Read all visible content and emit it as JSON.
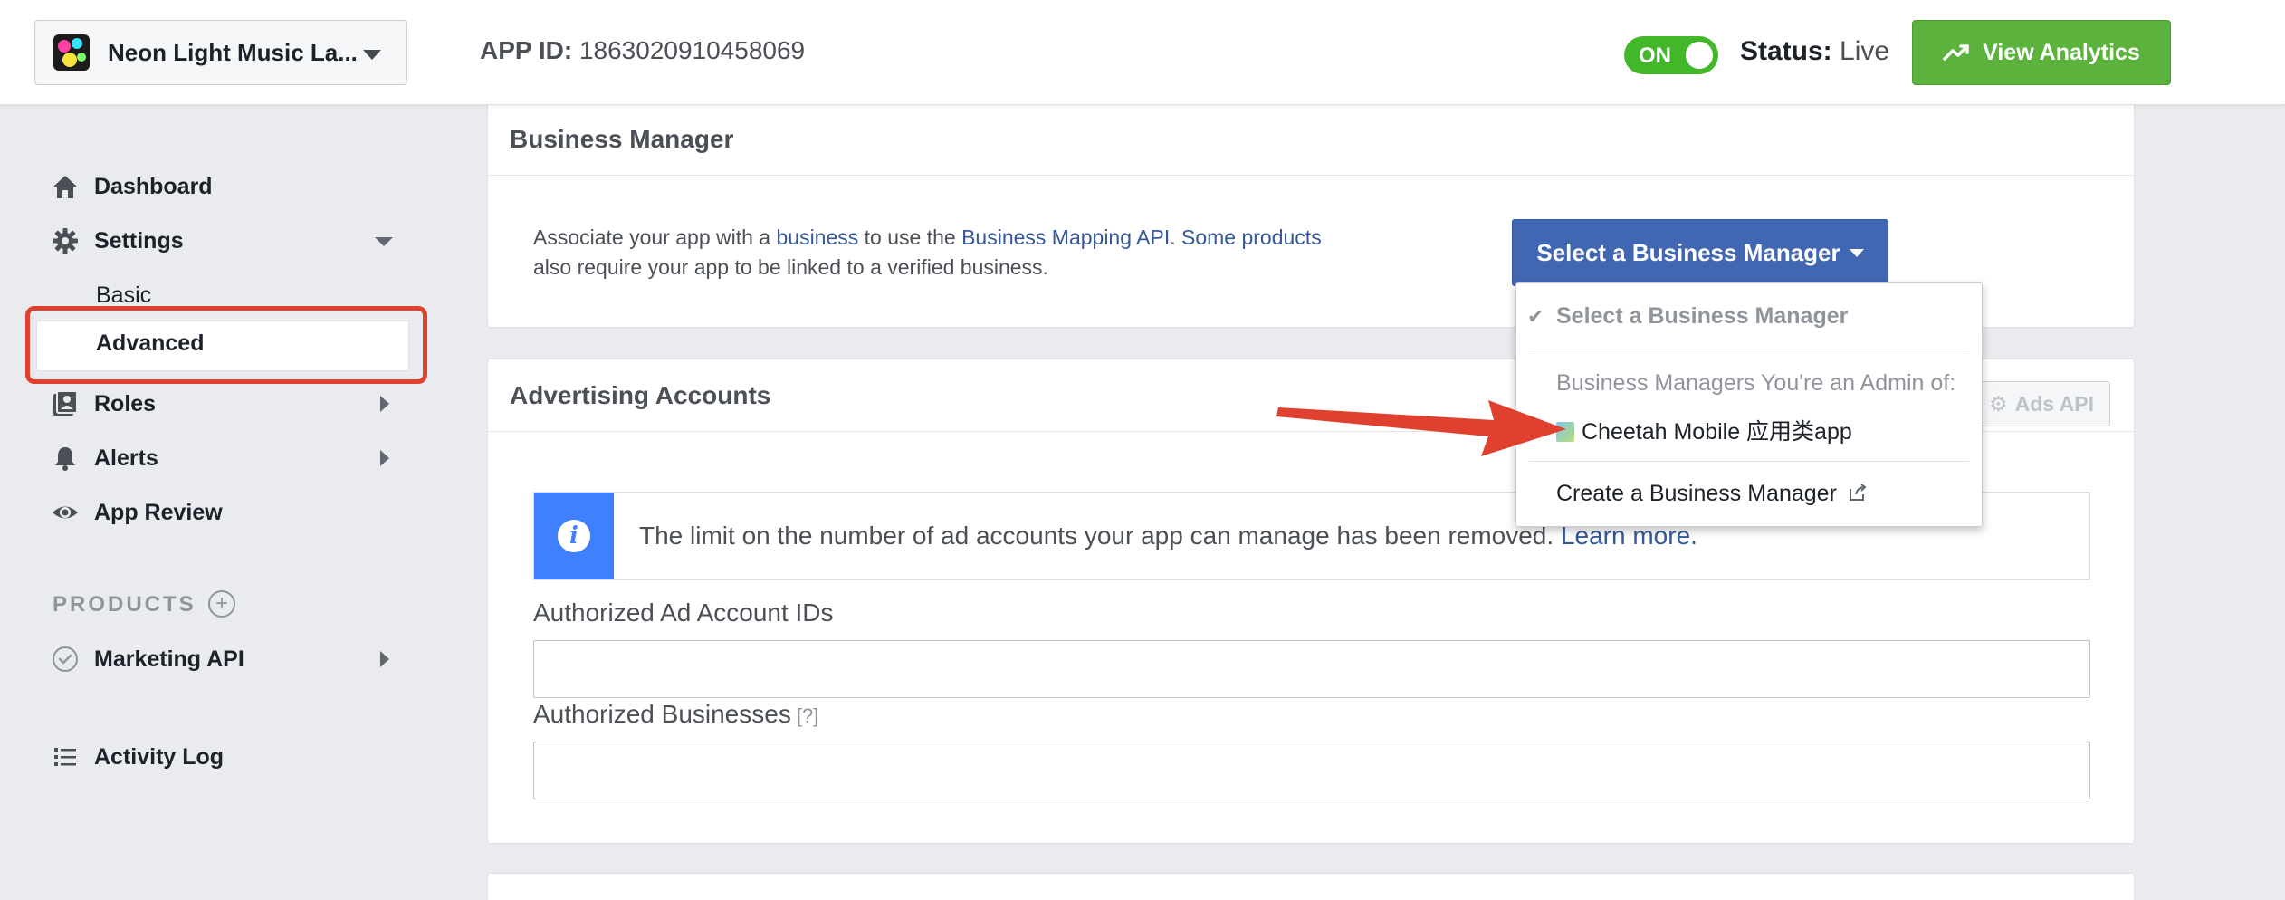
{
  "header": {
    "app_name": "Neon Light Music La...",
    "app_id_label": "APP ID:",
    "app_id_value": "1863020910458069",
    "toggle_label": "ON",
    "status_label": "Status:",
    "status_value": "Live",
    "analytics_label": "View Analytics"
  },
  "sidebar": {
    "dashboard": "Dashboard",
    "settings": "Settings",
    "basic": "Basic",
    "advanced": "Advanced",
    "roles": "Roles",
    "alerts": "Alerts",
    "app_review": "App Review",
    "products_heading": "PRODUCTS",
    "marketing_api": "Marketing API",
    "activity_log": "Activity Log"
  },
  "business_manager": {
    "title": "Business Manager",
    "desc_1": "Associate your app with a ",
    "link_business": "business",
    "desc_2": " to use the ",
    "link_mapping": "Business Mapping API",
    "desc_3": ". ",
    "link_products": "Some products",
    "desc_4": " also require your app to be linked to a verified business.",
    "select_button": "Select a Business Manager"
  },
  "dropdown": {
    "selected": "Select a Business Manager",
    "admin_heading": "Business Managers You're an Admin of:",
    "option_1": "Cheetah Mobile 应用类app",
    "create": "Create a Business Manager"
  },
  "advertising": {
    "title": "Advertising Accounts",
    "ads_api_label": "Ads API",
    "notice_text": "The limit on the number of ad accounts your app can manage has been removed. ",
    "notice_link": "Learn more.",
    "ad_ids_label": "Authorized Ad Account IDs",
    "ad_ids_value": "",
    "businesses_label": "Authorized Businesses",
    "businesses_hint": "[?]",
    "businesses_value": ""
  },
  "colors": {
    "accent_blue": "#4267b2",
    "live_green": "#42b72a",
    "analytics_green": "#5bb33d",
    "annotation_red": "#e0402f",
    "info_blue": "#4080ff"
  }
}
